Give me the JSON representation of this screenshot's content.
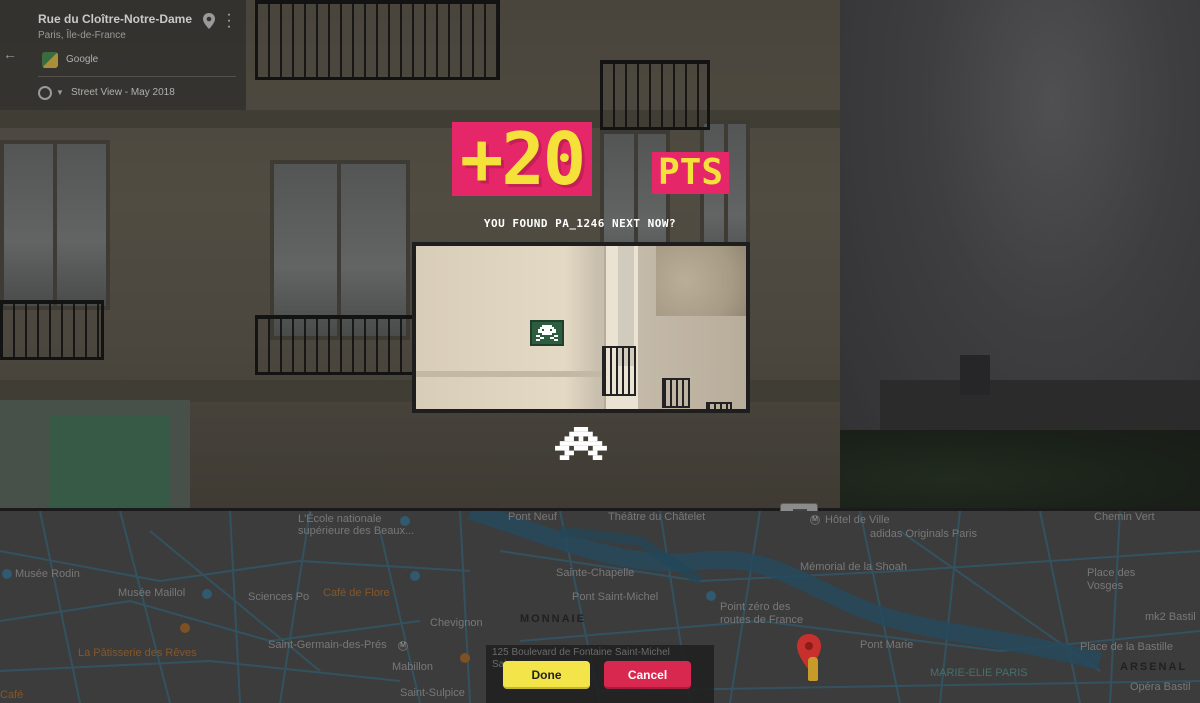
{
  "streetview_card": {
    "title": "Rue du Cloître-Notre-Dame",
    "subtitle": "Paris, Île-de-France",
    "provider": "Google",
    "capture": "Street View - May 2018"
  },
  "score": {
    "points": "+20",
    "unit": "PTS",
    "message": "YOU FOUND PA_1246 NEXT NOW?"
  },
  "map": {
    "labels": {
      "ecole": "L'École nationale",
      "ecole2": "supérieure des Beaux...",
      "pont_neuf": "Pont Neuf",
      "chatelet": "Théâtre du Châtelet",
      "hotel_ville": "Hôtel de Ville",
      "chemin_vert": "Chemin Vert",
      "adidas": "adidas Originals Paris",
      "rodin": "Musée Rodin",
      "maillol": "Musée Maillol",
      "sciences_po": "Sciences Po",
      "flore": "Café de Flore",
      "chevignon": "Chevignon",
      "sainte_chapelle": "Sainte-Chapelle",
      "st_michel": "Pont Saint-Michel",
      "monnaie": "MONNAIE",
      "memorial": "Mémorial de la Shoah",
      "place_vosges": "Place des",
      "place_vosges2": "Vosges",
      "point_zero": "Point zéro des",
      "point_zero2": "routes de France",
      "pont_marie": "Pont Marie",
      "mk2": "mk2 Bastil",
      "st_germain": "Saint-Germain-des-Prés",
      "mabillon": "Mabillon",
      "patisserie": "La Pâtisserie des Rêves",
      "marie_elie": "MARIE-ELIE PARIS",
      "place_bastille": "Place de la Bastille",
      "arsenal": "ARSENAL",
      "opera": "Opéra Bastil",
      "st_sulpice": "Saint-Sulpice",
      "cafe": "Café"
    },
    "address_line1": "125 Boulevard de Fontaine Saint-Michel",
    "address_line2": "Saint"
  },
  "actions": {
    "done": "Done",
    "cancel": "Cancel"
  }
}
